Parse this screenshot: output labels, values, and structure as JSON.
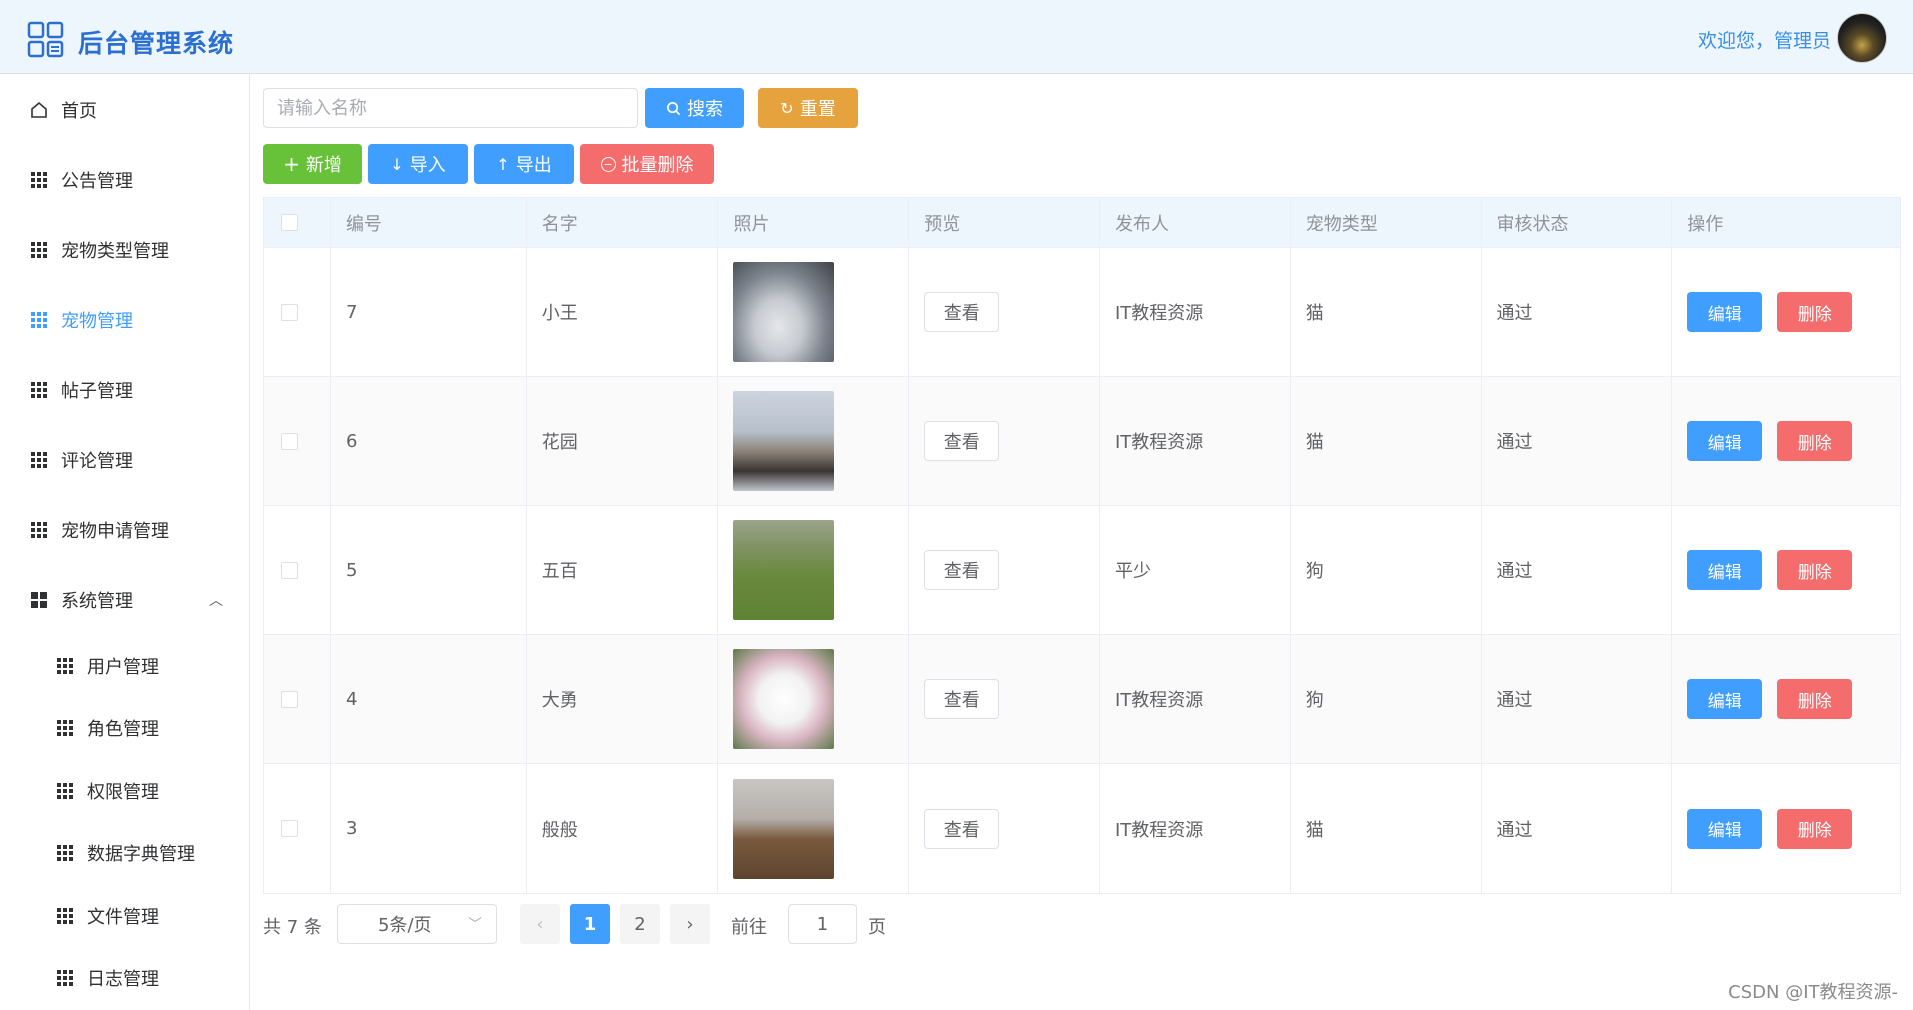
{
  "app": {
    "title": "后台管理系统",
    "welcome": "欢迎您，管理员"
  },
  "sidebar": {
    "items": [
      {
        "label": "首页",
        "icon": "home-icon"
      },
      {
        "label": "公告管理",
        "icon": "grid-icon"
      },
      {
        "label": "宠物类型管理",
        "icon": "grid-icon"
      },
      {
        "label": "宠物管理",
        "icon": "grid-icon",
        "active": true
      },
      {
        "label": "帖子管理",
        "icon": "grid-icon"
      },
      {
        "label": "评论管理",
        "icon": "grid-icon"
      },
      {
        "label": "宠物申请管理",
        "icon": "grid-icon"
      },
      {
        "label": "系统管理",
        "icon": "menu-icon",
        "expanded": true
      }
    ],
    "sub_items": [
      {
        "label": "用户管理"
      },
      {
        "label": "角色管理"
      },
      {
        "label": "权限管理"
      },
      {
        "label": "数据字典管理"
      },
      {
        "label": "文件管理"
      },
      {
        "label": "日志管理"
      }
    ]
  },
  "search": {
    "placeholder": "请输入名称",
    "search_label": "搜索",
    "reset_label": "重置"
  },
  "toolbar": {
    "add_label": "新增",
    "import_label": "导入",
    "export_label": "导出",
    "batch_delete_label": "批量删除"
  },
  "table": {
    "headers": [
      "编号",
      "名字",
      "照片",
      "预览",
      "发布人",
      "宠物类型",
      "审核状态",
      "操作"
    ],
    "view_label": "查看",
    "edit_label": "编辑",
    "delete_label": "删除",
    "rows": [
      {
        "id": "7",
        "name": "小王",
        "publisher": "IT教程资源",
        "type": "猫",
        "status": "通过"
      },
      {
        "id": "6",
        "name": "花园",
        "publisher": "IT教程资源",
        "type": "猫",
        "status": "通过"
      },
      {
        "id": "5",
        "name": "五百",
        "publisher": "平少",
        "type": "狗",
        "status": "通过"
      },
      {
        "id": "4",
        "name": "大勇",
        "publisher": "IT教程资源",
        "type": "狗",
        "status": "通过"
      },
      {
        "id": "3",
        "name": "般般",
        "publisher": "IT教程资源",
        "type": "猫",
        "status": "通过"
      }
    ]
  },
  "pagination": {
    "total": "共 7 条",
    "page_size": "5条/页",
    "pages": [
      "1",
      "2"
    ],
    "current": "1",
    "goto_label": "前往",
    "goto_value": "1",
    "page_suffix": "页"
  },
  "watermark": "CSDN @IT教程资源-"
}
